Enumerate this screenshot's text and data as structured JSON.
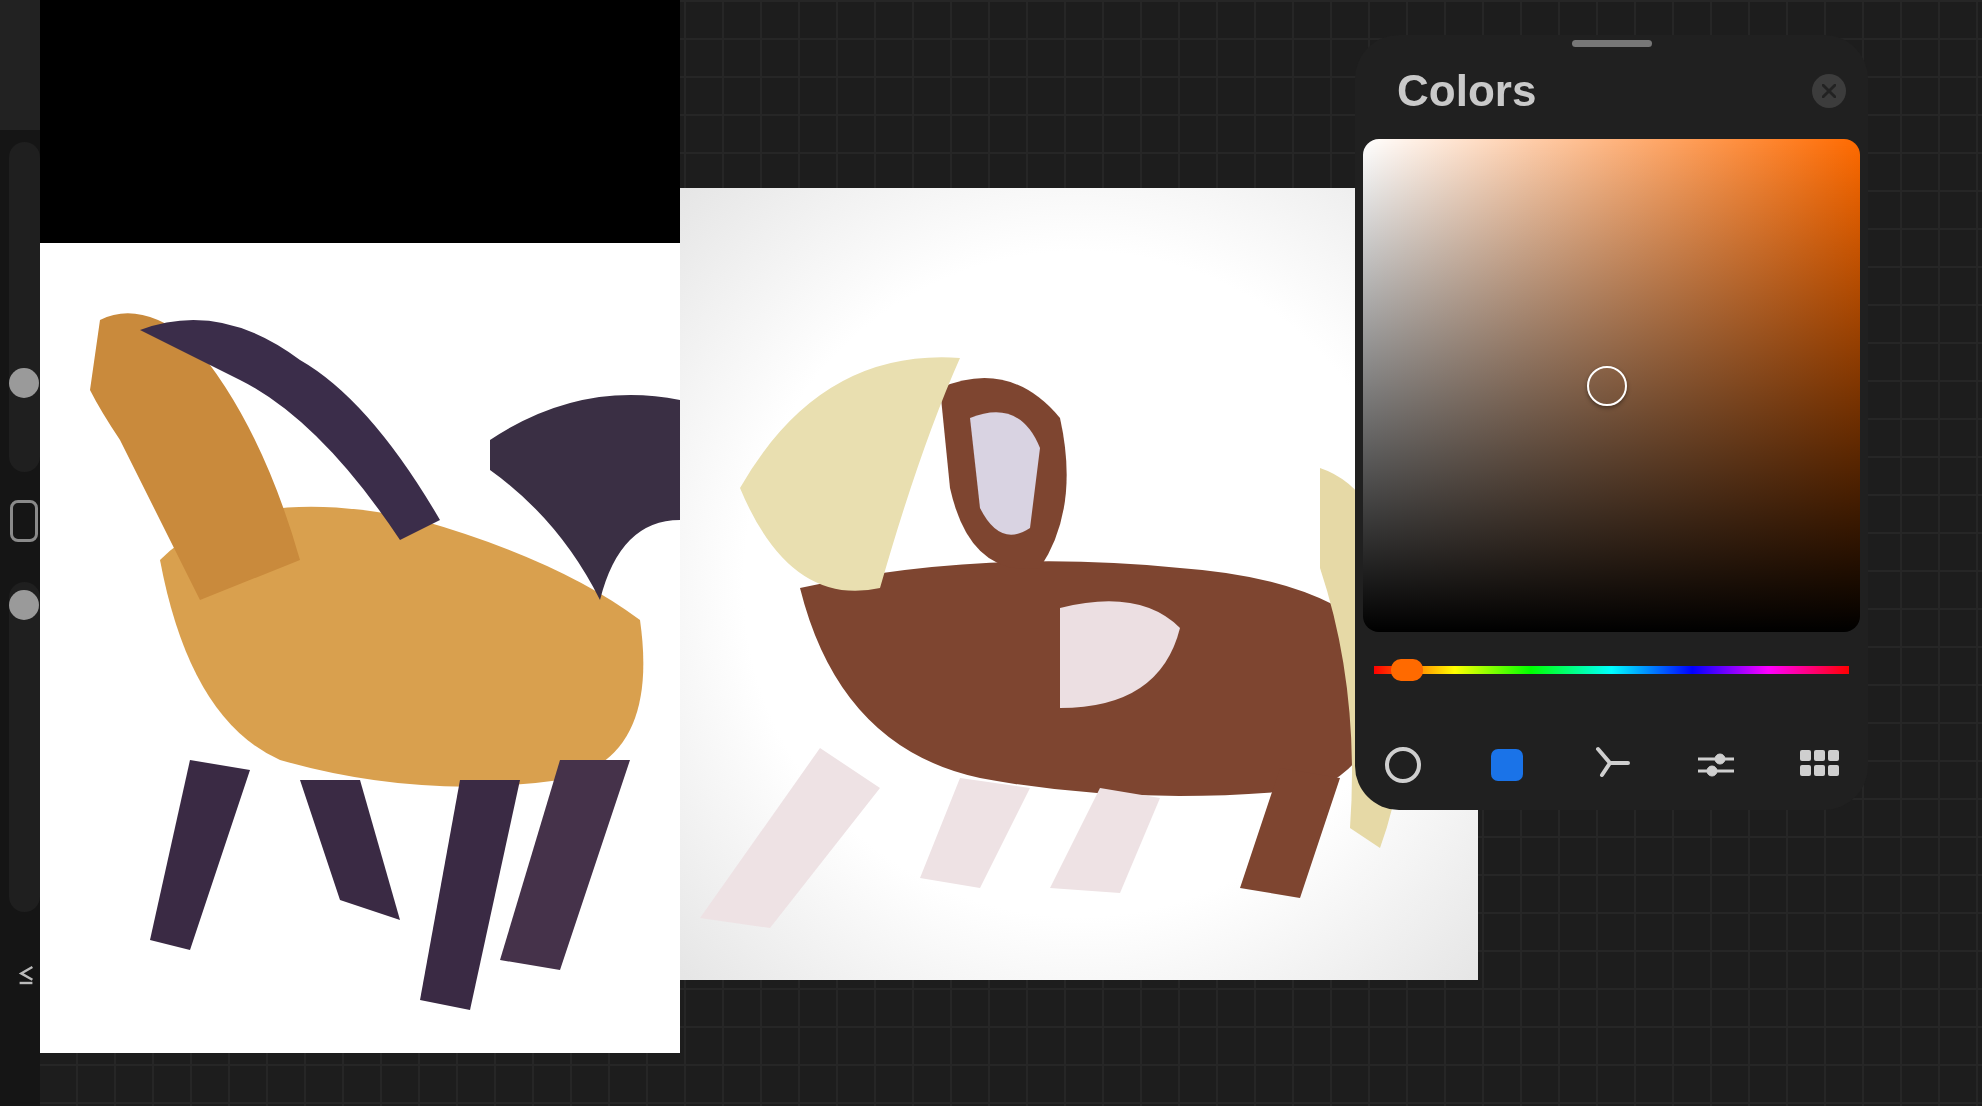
{
  "sidebar": {
    "sliders": [
      {
        "level": 0.27
      },
      {
        "level": 0.93
      }
    ]
  },
  "color_panel": {
    "title": "Colors",
    "picker": {
      "saturation": {
        "level": 0.49
      },
      "brightness": {
        "level": 0.5
      }
    },
    "hue": {
      "level": 0.07
    },
    "modes": [
      {
        "kind": "disc",
        "selected": false
      },
      {
        "kind": "classic",
        "selected": true
      },
      {
        "kind": "harmony",
        "selected": false
      },
      {
        "kind": "value",
        "selected": false
      },
      {
        "kind": "palettes",
        "selected": false
      }
    ]
  }
}
